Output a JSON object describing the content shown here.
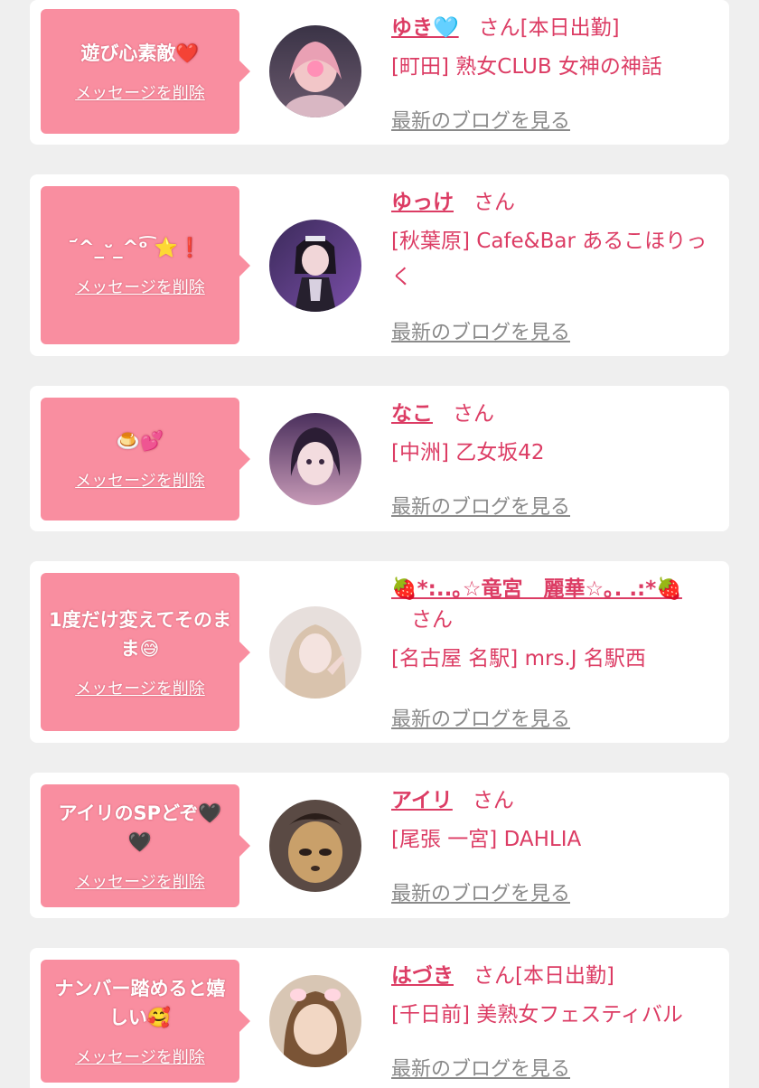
{
  "delete_label": "メッセージを削除",
  "blog_label": "最新のブログを見る",
  "colors": {
    "accent_pink": "#f98ea0",
    "name_text": "#dc3c64",
    "muted_link": "#8a8a8a",
    "page_bg": "#efefef"
  },
  "items": [
    {
      "message": "遊び心素敵❤️",
      "name": "ゆき🩵",
      "honorific": "さん[本日出勤]",
      "shop": "[町田] 熟女CLUB 女神の神話",
      "avatar": "avatar-photo"
    },
    {
      "message": "᷄^_ᵕ_^ᵒ͡ ⭐❗",
      "name": "ゆっけ",
      "honorific": "さん",
      "shop": "[秋葉原] Cafe&Bar あるこほりっく",
      "avatar": "avatar-photo"
    },
    {
      "message": "🍮💕",
      "name": "なこ",
      "honorific": "さん",
      "shop": "[中洲] 乙女坂42",
      "avatar": "avatar-photo"
    },
    {
      "message": "1度だけ変えてそのまま😅",
      "name": "🍓*:..｡☆竜宮　麗華☆｡. .:*🍓",
      "honorific": "さん",
      "shop": "[名古屋 名駅] mrs.J 名駅西",
      "avatar": "avatar-photo"
    },
    {
      "message": "アイリのSPどぞ🖤🖤",
      "name": "アイリ",
      "honorific": "さん",
      "shop": "[尾張 一宮] DAHLIA",
      "avatar": "avatar-photo"
    },
    {
      "message": "ナンバー踏めると嬉しい🥰",
      "name": "はづき",
      "honorific": "さん[本日出勤]",
      "shop": "[千日前] 美熟女フェスティバル",
      "avatar": "avatar-photo"
    }
  ]
}
